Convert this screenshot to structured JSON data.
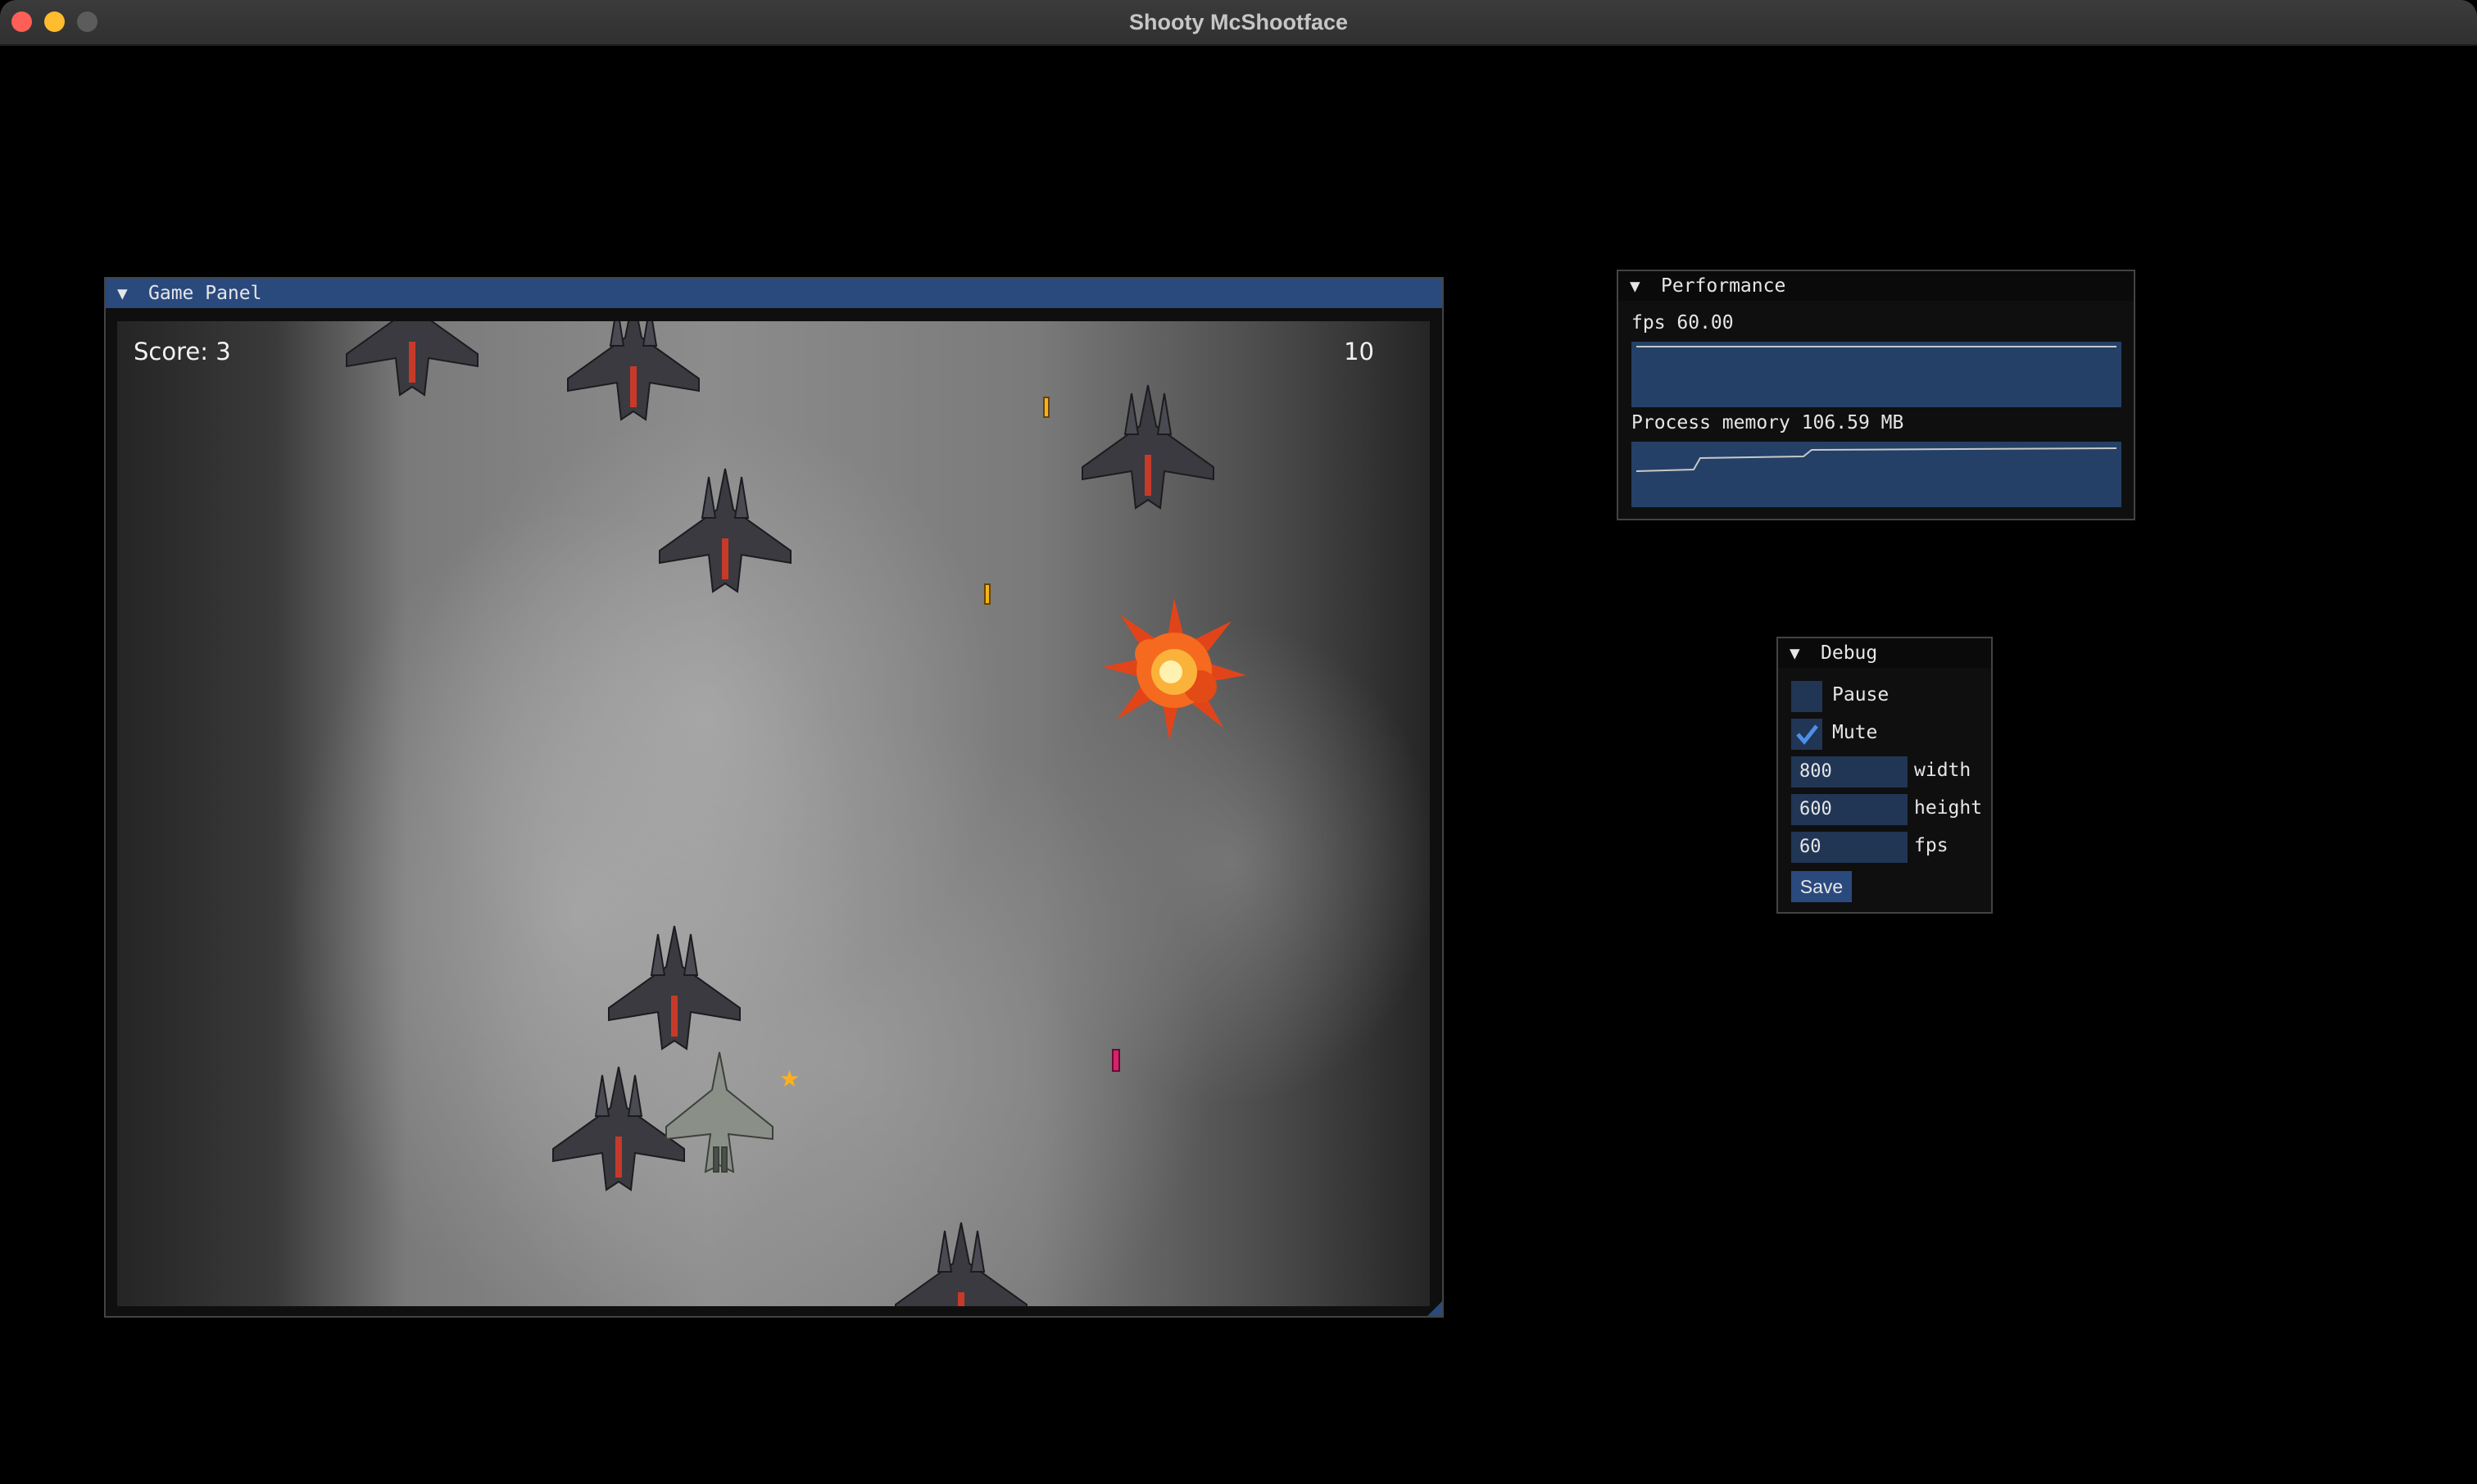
{
  "window": {
    "title": "Shooty McShootface"
  },
  "game_panel": {
    "title": "Game Panel",
    "collapse_icon": "triangle-down-icon",
    "score_text": "Score: 3",
    "lives_text": "10"
  },
  "performance": {
    "title": "Performance",
    "collapse_icon": "triangle-down-icon",
    "fps_label": "fps 60.00",
    "memory_label": "Process memory 106.59 MB"
  },
  "debug": {
    "title": "Debug",
    "collapse_icon": "triangle-down-icon",
    "pause_label": "Pause",
    "pause_checked": false,
    "mute_label": "Mute",
    "mute_checked": true,
    "width_value": "800",
    "width_label": "width",
    "height_value": "600",
    "height_label": "height",
    "fps_value": "60",
    "fps_label": "fps",
    "save_label": "Save"
  },
  "colors": {
    "accent": "#2a4a7e",
    "frame_bg": "#213555",
    "plot_bg": "#244066",
    "bullet_yellow": "#f1b51b",
    "bullet_pink": "#d6226e"
  }
}
